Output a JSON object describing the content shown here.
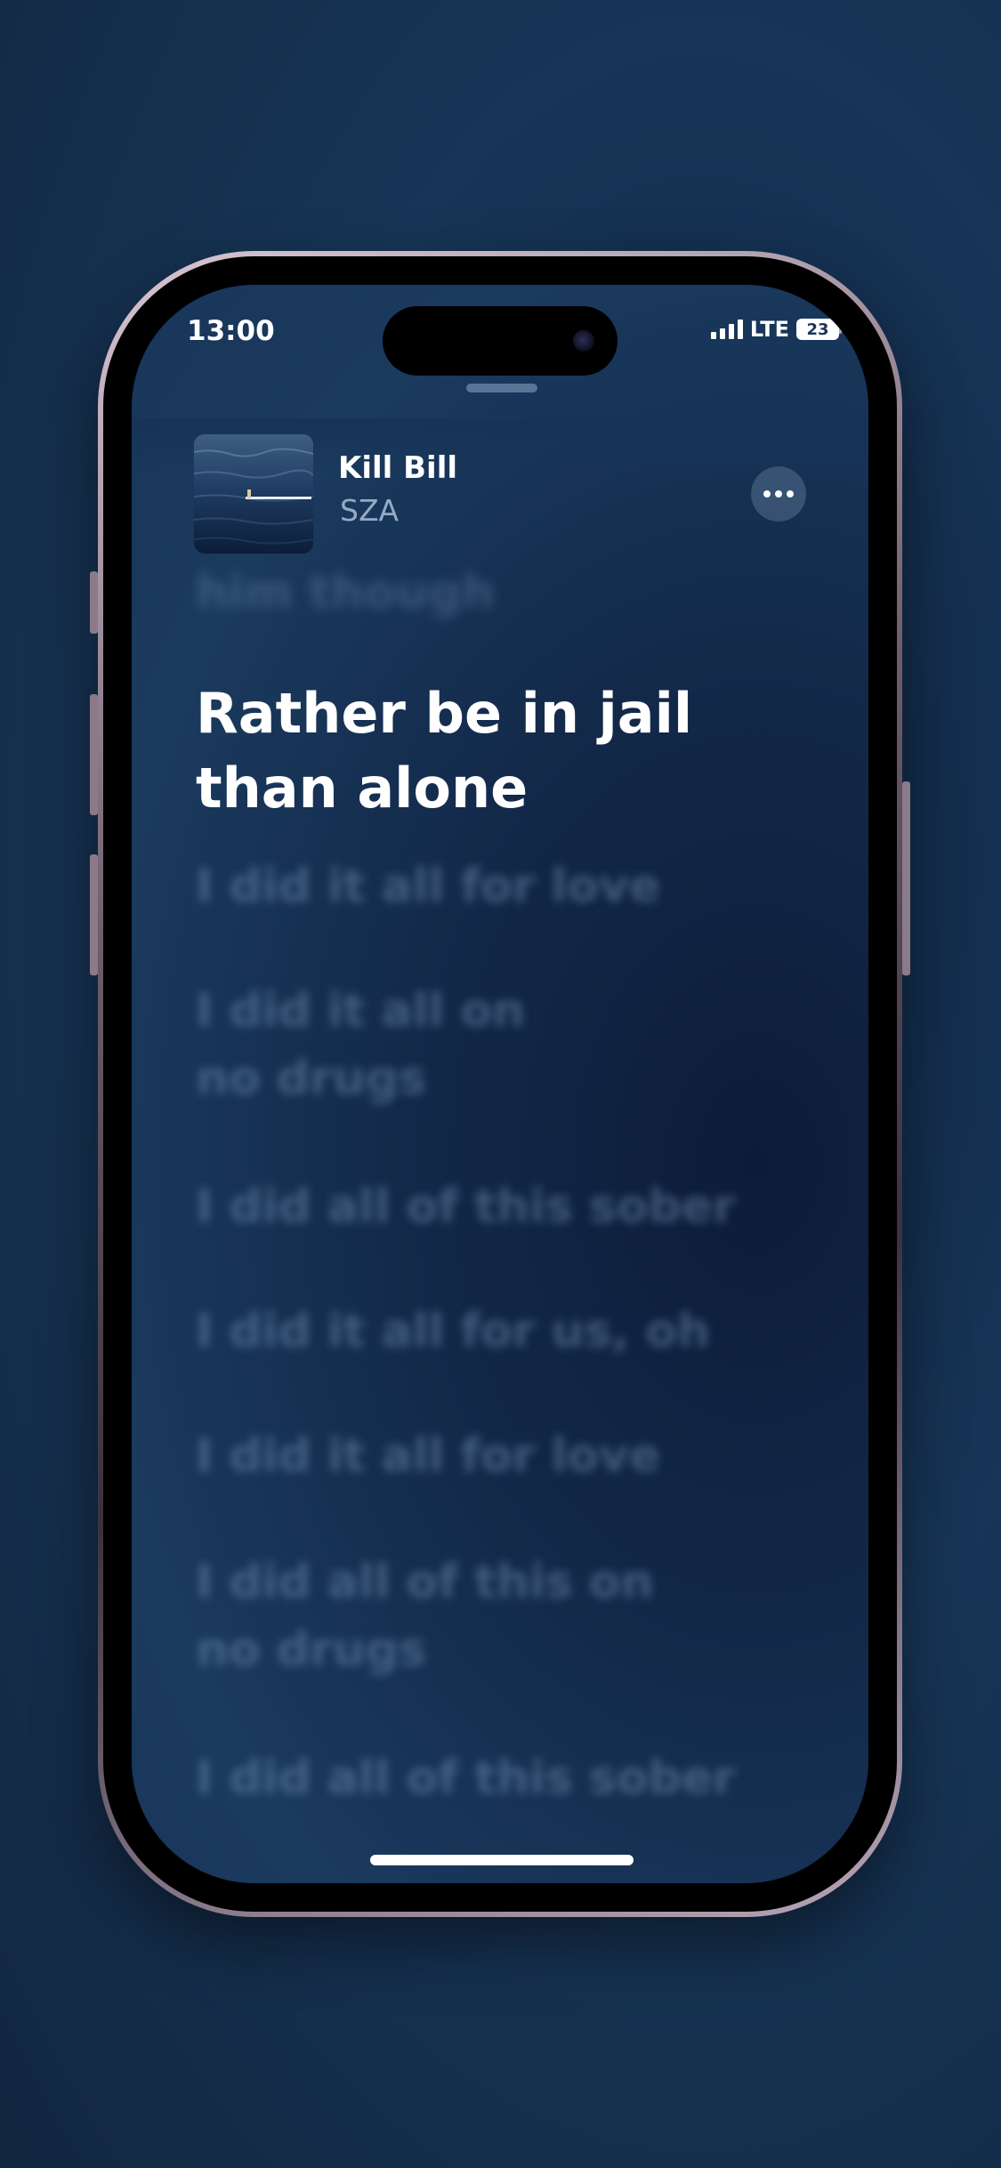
{
  "status_bar": {
    "time": "13:00",
    "network": "LTE",
    "battery": "23"
  },
  "now_playing": {
    "title": "Kill Bill",
    "artist": "SZA"
  },
  "lyrics": {
    "previous": "him though",
    "current": [
      "Rather be in jail",
      "than alone"
    ],
    "upcoming": [
      [
        "I did it all for love"
      ],
      [
        "I did it all on",
        "no drugs"
      ],
      [
        "I did all of this sober"
      ],
      [
        "I did it all for us, oh"
      ],
      [
        "I did it all for love"
      ],
      [
        "I did all of this on",
        "no drugs"
      ],
      [
        "I did all of this sober"
      ]
    ]
  },
  "colors": {
    "background": "#173557",
    "current_lyric": "#ffffff",
    "dim_lyric": "#7896b9"
  },
  "icons": {
    "more": "more-horizontal-icon",
    "signal": "cellular-signal-icon",
    "battery": "battery-icon"
  }
}
